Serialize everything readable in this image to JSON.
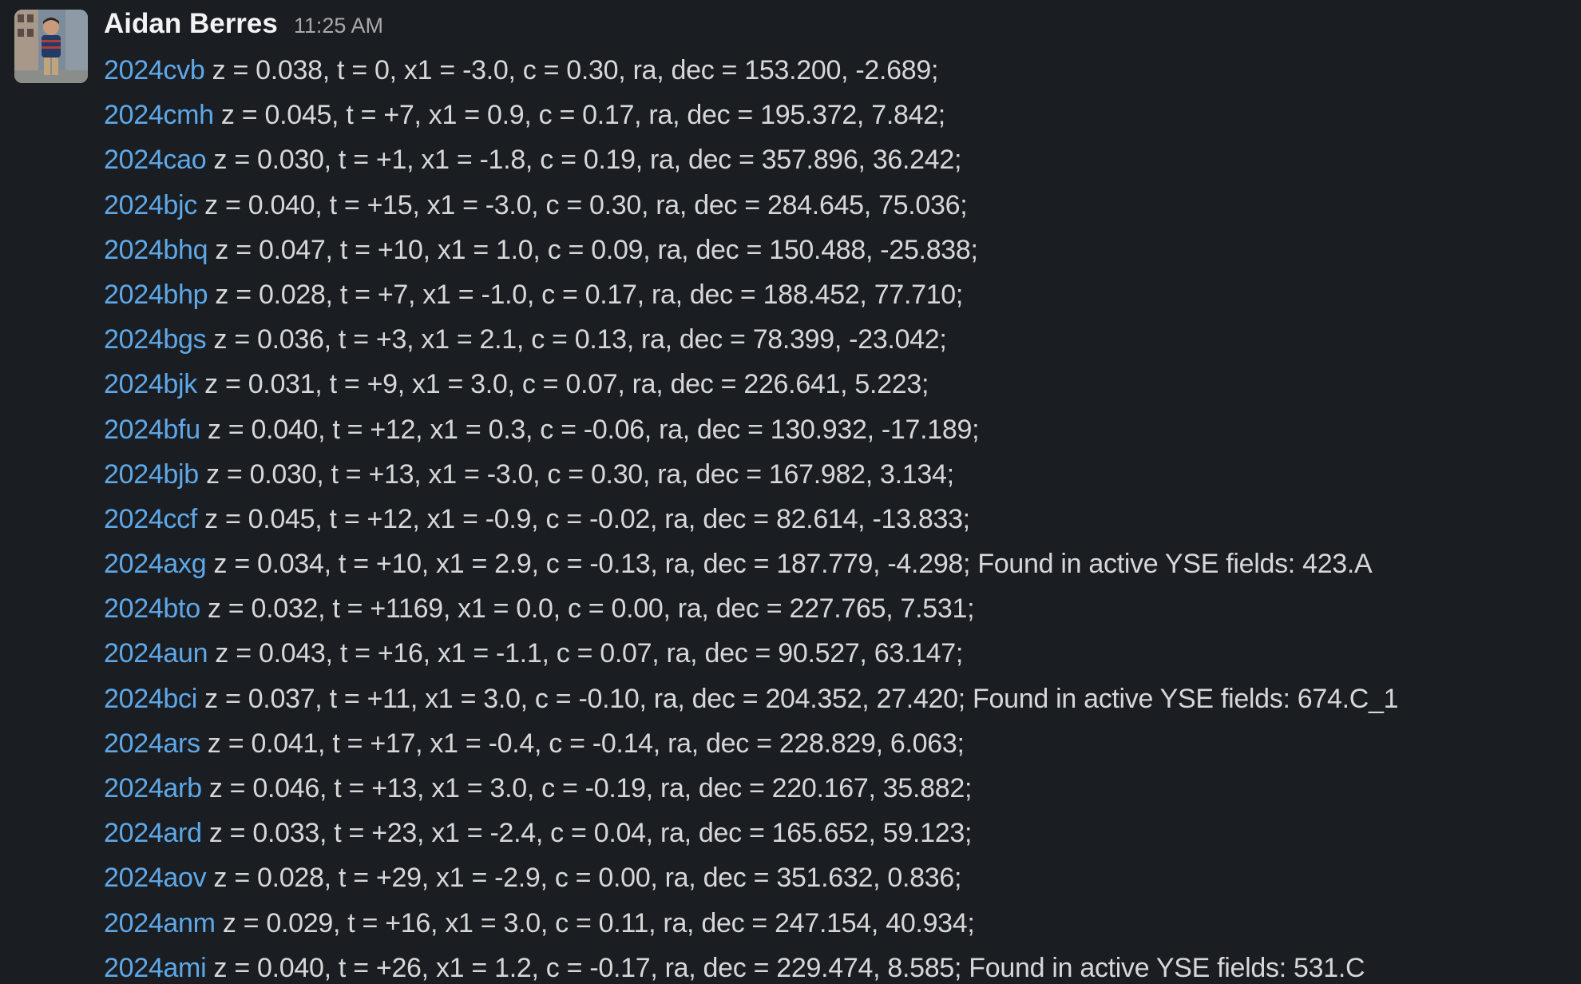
{
  "message": {
    "author": "Aidan Berres",
    "timestamp": "11:25 AM",
    "lines": [
      {
        "name": "2024cvb",
        "text": " z = 0.038, t = 0, x1 = -3.0, c = 0.30, ra, dec = 153.200, -2.689;"
      },
      {
        "name": "2024cmh",
        "text": " z = 0.045, t = +7, x1 = 0.9, c = 0.17, ra, dec = 195.372, 7.842;"
      },
      {
        "name": "2024cao",
        "text": " z = 0.030, t = +1, x1 = -1.8, c = 0.19, ra, dec = 357.896, 36.242;"
      },
      {
        "name": "2024bjc",
        "text": " z = 0.040, t = +15, x1 = -3.0, c = 0.30, ra, dec = 284.645, 75.036;"
      },
      {
        "name": "2024bhq",
        "text": " z = 0.047, t = +10, x1 = 1.0, c = 0.09, ra, dec = 150.488, -25.838;"
      },
      {
        "name": "2024bhp",
        "text": " z = 0.028, t = +7, x1 = -1.0, c = 0.17, ra, dec = 188.452, 77.710;"
      },
      {
        "name": "2024bgs",
        "text": " z = 0.036, t = +3, x1 = 2.1, c = 0.13, ra, dec = 78.399, -23.042;"
      },
      {
        "name": "2024bjk",
        "text": " z = 0.031, t = +9, x1 = 3.0, c = 0.07, ra, dec = 226.641, 5.223;"
      },
      {
        "name": "2024bfu",
        "text": " z = 0.040, t = +12, x1 = 0.3, c = -0.06, ra, dec = 130.932, -17.189;"
      },
      {
        "name": "2024bjb",
        "text": " z = 0.030, t = +13, x1 = -3.0, c = 0.30, ra, dec = 167.982, 3.134;"
      },
      {
        "name": "2024ccf",
        "text": " z = 0.045, t = +12, x1 = -0.9, c = -0.02, ra, dec = 82.614, -13.833;"
      },
      {
        "name": "2024axg",
        "text": " z = 0.034, t = +10, x1 = 2.9, c = -0.13, ra, dec = 187.779, -4.298; Found in active YSE fields: 423.A"
      },
      {
        "name": "2024bto",
        "text": " z = 0.032, t = +1169, x1 = 0.0, c = 0.00, ra, dec = 227.765, 7.531;"
      },
      {
        "name": "2024aun",
        "text": " z = 0.043, t = +16, x1 = -1.1, c = 0.07, ra, dec = 90.527, 63.147;"
      },
      {
        "name": "2024bci",
        "text": " z = 0.037, t = +11, x1 = 3.0, c = -0.10, ra, dec = 204.352, 27.420; Found in active YSE fields: 674.C_1"
      },
      {
        "name": "2024ars",
        "text": " z = 0.041, t = +17, x1 = -0.4, c = -0.14, ra, dec = 228.829, 6.063;"
      },
      {
        "name": "2024arb",
        "text": " z = 0.046, t = +13, x1 = 3.0, c = -0.19, ra, dec = 220.167, 35.882;"
      },
      {
        "name": "2024ard",
        "text": " z = 0.033, t = +23, x1 = -2.4, c = 0.04, ra, dec = 165.652, 59.123;"
      },
      {
        "name": "2024aov",
        "text": " z = 0.028, t = +29, x1 = -2.9, c = 0.00, ra, dec = 351.632, 0.836;"
      },
      {
        "name": "2024anm",
        "text": " z = 0.029, t = +16, x1 = 3.0, c = 0.11, ra, dec = 247.154, 40.934;"
      },
      {
        "name": "2024ami",
        "text": " z = 0.040, t = +26, x1 = 1.2, c = -0.17, ra, dec = 229.474, 8.585; Found in active YSE fields: 531.C"
      }
    ]
  },
  "colors": {
    "background": "#1a1d21",
    "link": "#5fa8e8",
    "text": "#d6d7d8",
    "author": "#f2f3f4",
    "timestamp": "#a8a9aa"
  },
  "icons": {
    "avatar": "user-avatar-photo"
  }
}
